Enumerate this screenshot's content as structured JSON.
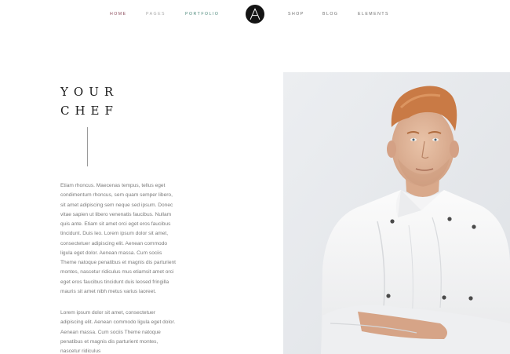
{
  "nav": {
    "left_items": [
      "HOME",
      "PAGES",
      "PORTFOLIO"
    ],
    "right_items": [
      "SHOP",
      "BLOG",
      "ELEMENTS"
    ],
    "logo_letter": "Λ"
  },
  "hero": {
    "title_line_1": "YOUR",
    "title_line_2": "CHEF"
  },
  "content": {
    "paragraph_1_lines": [
      "Etiam rhoncus. Maecenas tempus, tellus eget",
      "condimentum rhoncus, sem quam semper libero,",
      "sit amet adipiscing sem neque sed ipsum. Donec",
      "vitae sapien ut libero venenatis faucibus. Nullam",
      "quis ante. Etiam sit amet orci eget eros faucibus",
      "tincidunt. Duis leo. Lorem ipsum dolor sit amet,",
      "consectetuer adipiscing elit. Aenean commodo",
      "ligula eget dolor. Aenean massa. Cum sociis",
      "Theme natoque penatibus et magnis dis parturient",
      "montes, nascetur ridiculus mus etiamsit amet orci",
      "eget eros faucibus tincidunt duis leosed fringilla",
      "mauris sit amet nibh metus varius laoreet."
    ],
    "paragraph_2_lines": [
      "Lorem ipsum dolor sit amet, consectetuer",
      "adipiscing elit. Aenean commodo ligula eget dolor.",
      "Aenean massa. Cum sociis Theme natoque",
      "penatibus et magnis dis parturient montes,",
      "nascetur ridiculus"
    ]
  },
  "colors": {
    "text_dark": "#1b1b1b",
    "text_body": "#7a7a7a",
    "nav_home": "#8b4a5a",
    "nav_accent": "#4f8a7c",
    "logo_bg": "#141414",
    "photo_bg": "#e9ebee"
  }
}
